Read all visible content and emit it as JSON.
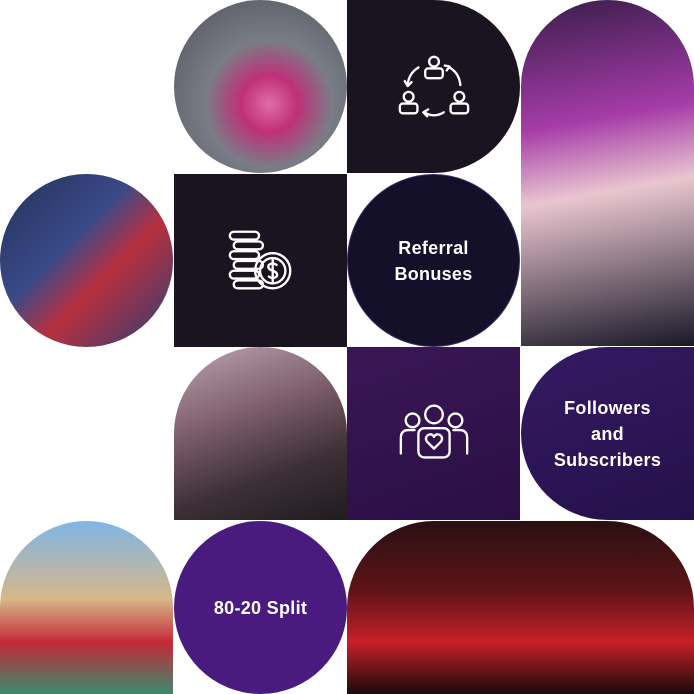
{
  "tiles": {
    "referral": {
      "label_line1": "Referral",
      "label_line2": "Bonuses",
      "icon": "referral-cycle-icon"
    },
    "followers": {
      "label_line1": "Followers",
      "label_line2": "and",
      "label_line3": "Subscribers",
      "icon": "followers-heart-icon"
    },
    "split": {
      "label": "80-20 Split",
      "icon": "coins-dollar-icon"
    }
  },
  "colors": {
    "dark_tile": "#1a1420",
    "navy_circle": "#151029",
    "purple": "#4a1b7e",
    "text": "#ffffff"
  }
}
